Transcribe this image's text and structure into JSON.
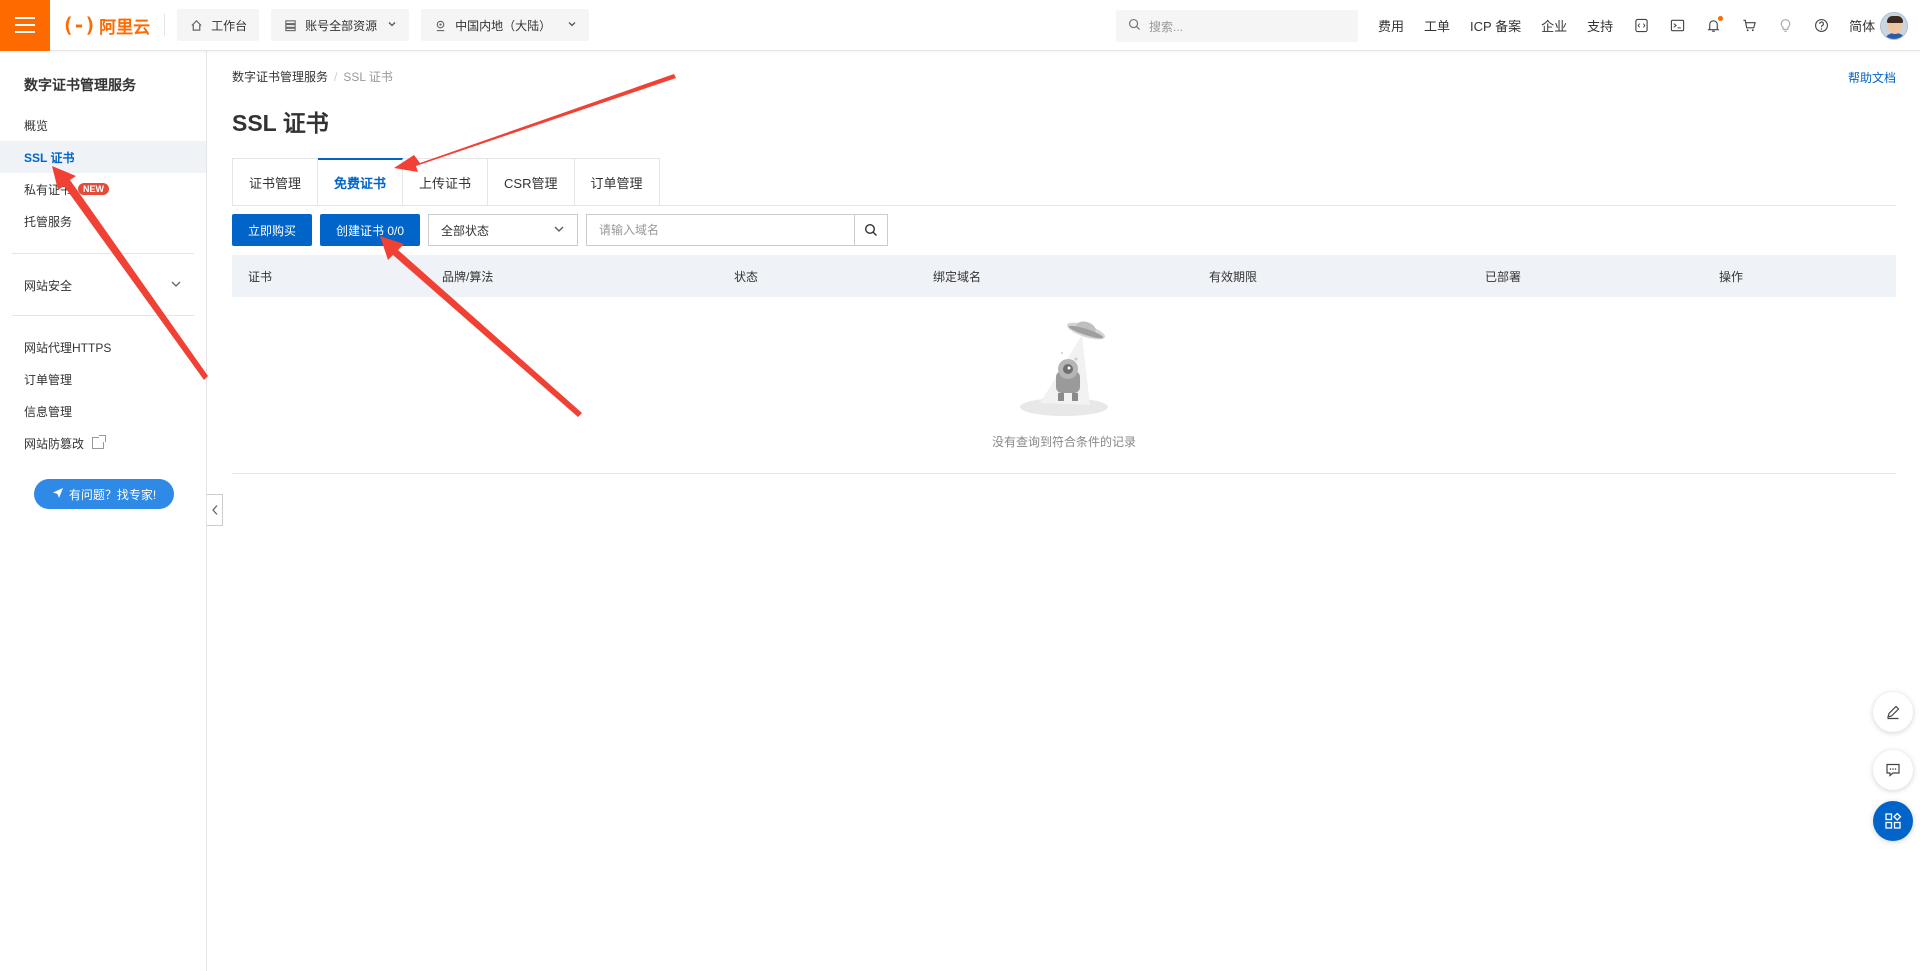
{
  "topbar": {
    "logo_mark": "(-)",
    "logo_text": "阿里云",
    "workbench": "工作台",
    "resources": "账号全部资源",
    "region": "中国内地（大陆）",
    "search_placeholder": "搜索...",
    "links": [
      "费用",
      "工单",
      "ICP 备案",
      "企业",
      "支持"
    ],
    "lang": "简体",
    "accent_color": "#ff6a00"
  },
  "sidebar": {
    "title": "数字证书管理服务",
    "items": [
      {
        "label": "概览"
      },
      {
        "label": "SSL 证书"
      },
      {
        "label": "私有证书",
        "badge": "NEW"
      },
      {
        "label": "托管服务"
      },
      {
        "label": "网站安全"
      },
      {
        "label": "网站代理HTTPS"
      },
      {
        "label": "订单管理"
      },
      {
        "label": "信息管理"
      },
      {
        "label": "网站防篡改"
      }
    ],
    "expert_button": "有问题？找专家!"
  },
  "main": {
    "breadcrumb": [
      "数字证书管理服务",
      "SSL 证书"
    ],
    "help": "帮助文档",
    "title": "SSL 证书",
    "tabs": [
      "证书管理",
      "免费证书",
      "上传证书",
      "CSR管理",
      "订单管理"
    ],
    "active_tab": "免费证书",
    "toolbar": {
      "buy": "立即购买",
      "create": "创建证书 0/0",
      "status_select": "全部状态",
      "domain_placeholder": "请输入域名"
    },
    "table": {
      "columns": [
        "证书",
        "品牌/算法",
        "状态",
        "绑定域名",
        "有效期限",
        "已部署",
        "操作"
      ],
      "empty_text": "没有查询到符合条件的记录"
    },
    "primary_color": "#0064c8"
  }
}
